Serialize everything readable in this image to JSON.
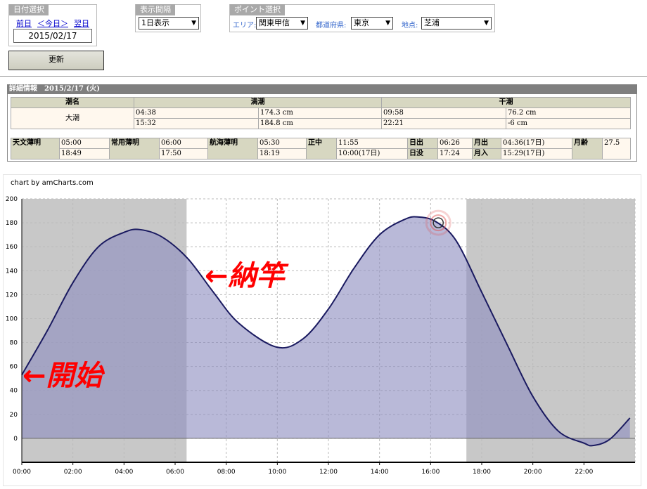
{
  "date_panel": {
    "title": "日付選択",
    "prev": "前日",
    "today": "＜今日＞",
    "next": "翌日",
    "date": "2015/02/17"
  },
  "interval_panel": {
    "title": "表示間隔",
    "value": "1日表示"
  },
  "point_panel": {
    "title": "ポイント選択",
    "area_label": "エリア:",
    "area": "関東甲信",
    "pref_label": "都道府県:",
    "pref": "東京",
    "spot_label": "地点:",
    "spot": "芝浦"
  },
  "update_button": "更新",
  "detail": {
    "header": "詳細情報　2015/2/17 (火)",
    "tide_name_h": "潮名",
    "high_h": "満潮",
    "low_h": "干潮",
    "tide_name": "大潮",
    "high": [
      [
        "04:38",
        "174.3 cm"
      ],
      [
        "15:32",
        "184.8 cm"
      ]
    ],
    "low": [
      [
        "09:58",
        "76.2 cm"
      ],
      [
        "22:21",
        "-6 cm"
      ]
    ],
    "astro": {
      "astronomical_label": "天文薄明",
      "astronomical": [
        "05:00",
        "18:49"
      ],
      "civil_label": "常用薄明",
      "civil": [
        "06:00",
        "17:50"
      ],
      "nautical_label": "航海薄明",
      "nautical": [
        "05:30",
        "18:19"
      ],
      "noon_label": "正中",
      "noon": [
        "11:55",
        "10:00(17日)"
      ],
      "sunrise_label": "日出",
      "sunrise": "06:26",
      "sunset_label": "日没",
      "sunset": "17:24",
      "moonrise_label": "月出",
      "moonrise": "04:36(17日)",
      "moonset_label": "月入",
      "moonset": "15:29(17日)",
      "moonage_label": "月齢",
      "moonage": "27.5"
    }
  },
  "chart_credit": "chart by amCharts.com",
  "annotations": {
    "start": "←開始",
    "end": "←納竿"
  },
  "colors": {
    "fill": "#8e8ec0",
    "line": "#1a1a60",
    "night": "#c8c8c8",
    "marker": "#e05050",
    "annotation": "#ff0000"
  },
  "chart_data": {
    "type": "area",
    "x_ticks": [
      "00:00",
      "02:00",
      "04:00",
      "06:00",
      "08:00",
      "10:00",
      "12:00",
      "14:00",
      "16:00",
      "18:00",
      "20:00",
      "22:00"
    ],
    "y_ticks": [
      0,
      20,
      40,
      60,
      80,
      100,
      120,
      140,
      160,
      180,
      200
    ],
    "xlim": [
      0,
      24
    ],
    "ylim": [
      -20,
      200
    ],
    "shade_ranges": [
      [
        0,
        6.45
      ],
      [
        17.4,
        24
      ]
    ],
    "x": [
      0,
      1,
      2,
      3,
      4,
      4.63,
      5.5,
      6.5,
      7.5,
      8.5,
      9.97,
      11,
      12,
      13,
      14,
      15,
      15.53,
      16.2,
      17,
      18,
      19,
      20,
      21,
      22,
      22.35,
      23,
      23.8
    ],
    "values": [
      53,
      90,
      130,
      160,
      172,
      174.3,
      168,
      150,
      122,
      96,
      76.2,
      83,
      108,
      142,
      170,
      183,
      184.8,
      181,
      165,
      122,
      78,
      35,
      6,
      -4,
      -6,
      -1,
      17
    ],
    "marker": {
      "x": 16.3,
      "y": 180
    },
    "grid": true
  }
}
